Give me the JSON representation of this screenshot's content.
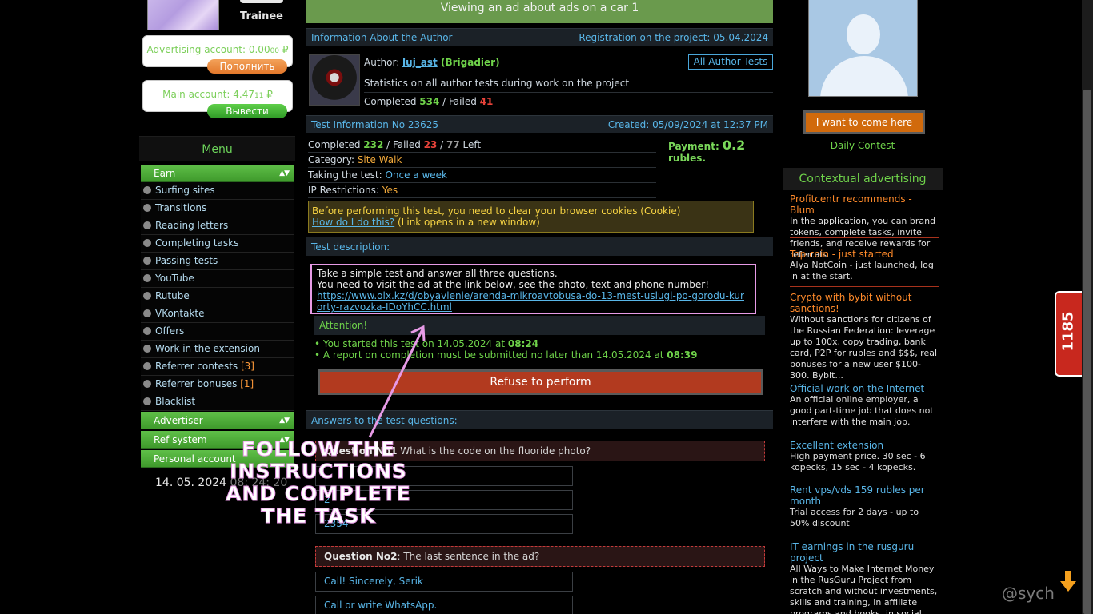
{
  "left": {
    "rank": "Trainee",
    "adv_account": {
      "label": "Advertising account: 0.00",
      "small": "00",
      "unit": " ₽",
      "button": "Пополнить"
    },
    "main_account": {
      "label": "Main account: 4.47",
      "small": "11",
      "unit": " ₽",
      "button": "Вывести"
    },
    "menu_title": "Menu",
    "earn_head": "Earn",
    "items": [
      {
        "label": "Surfing sites",
        "count": ""
      },
      {
        "label": "Transitions",
        "count": ""
      },
      {
        "label": "Reading letters",
        "count": ""
      },
      {
        "label": "Completing tasks",
        "count": ""
      },
      {
        "label": "Passing tests",
        "count": ""
      },
      {
        "label": "YouTube",
        "count": ""
      },
      {
        "label": "Rutube",
        "count": ""
      },
      {
        "label": "VKontakte",
        "count": ""
      },
      {
        "label": "Offers",
        "count": ""
      },
      {
        "label": "Work in the extension",
        "count": ""
      },
      {
        "label": "Referrer contests",
        "count": "[3]"
      },
      {
        "label": "Referrer bonuses",
        "count": "[1]"
      },
      {
        "label": "Blacklist",
        "count": ""
      }
    ],
    "advertiser_head": "Advertiser",
    "ref_head": "Ref system",
    "personal_head": "Personal account",
    "clock_date": "14. 05. 2024",
    "clock_time": "08: 24: 20"
  },
  "center": {
    "banner": "Viewing an ad about ads on a car 1",
    "author_bar": {
      "left": "Information About the Author",
      "right": "Registration on the project: 05.04.2024"
    },
    "author": {
      "label": "Author: ",
      "name": "luj_ast",
      "rank": " (Brigadier)",
      "all_tests": "All Author Tests",
      "stats_text": "Statistics on all author tests during work on the project",
      "completed_label": "Completed ",
      "completed": "534",
      "failed_label": " / Failed ",
      "failed": "41"
    },
    "test_bar": {
      "left": "Test Information No 23625",
      "right": "Created: 05/09/2024 at 12:37 PM"
    },
    "test": {
      "completed_label": "Completed ",
      "completed": "232",
      "failed_label": " / Failed ",
      "failed": "23",
      "sep": " / ",
      "left": "77",
      "left_label": " Left",
      "category_label": "Category: ",
      "category": "Site Walk",
      "taking_label": "Taking the test: ",
      "taking": "Once a week",
      "ip_label": "IP Restrictions: ",
      "ip": "Yes",
      "payment_label": "Payment: ",
      "payment": "0.2",
      "payment_unit": " rubles."
    },
    "cookie": {
      "line1": "Before performing this test, you need to clear your browser cookies (Cookie)",
      "link": "How do I do this?",
      "note": " (Link opens in a new window)"
    },
    "desc_title": "Test description:",
    "desc": {
      "line1": "Take a simple test and answer all three questions.",
      "line2": "You need to visit the ad at the link below, see the photo, text and phone number!",
      "url": "https://www.olx.kz/d/obyavlenie/arenda-mikroavtobusa-do-13-mest-uslugi-po-gorodu-kurorty-razvozka-IDoYhCC.html"
    },
    "attention": "Attention!",
    "bullet1": {
      "text": "• You started this test on 14.05.2024 at ",
      "time": "08:24"
    },
    "bullet2": {
      "text": "• A report on completion must be submitted no later than 14.05.2024 at ",
      "time": "08:39"
    },
    "refuse": "Refuse to perform",
    "answers_title": "Answers to the test questions:",
    "q1": {
      "label": "Question No1",
      "text": " What is the code on the fluoride photo?"
    },
    "q1_options": [
      "",
      "2",
      "2354"
    ],
    "q2": {
      "label": "Question No2",
      "text": ": The last sentence in the ad?"
    },
    "q2_options": [
      "Call! Sincerely, Serik",
      "Call or write WhatsApp."
    ],
    "overlay": "FOLLOW THE INSTRUCTIONS AND COMPLETE THE TASK"
  },
  "right": {
    "come_button": "I want to come here",
    "daily": "Daily Contest",
    "ctx_title": "Contextual advertising",
    "ads": [
      {
        "title": "Profitcentr recommends - Blum",
        "body": "In the application, you can brand tokens, complete tasks, invite friends, and receive rewards for referrals",
        "style": "orange"
      },
      {
        "title": "Top coin - just started",
        "body": "Alya NotCoin - just launched, log in at the start.",
        "style": "orange"
      },
      {
        "title": "Crypto with bybit without sanctions!",
        "body": "Without sanctions for citizens of the Russian Federation: leverage up to 100x, copy trading, bank card, P2P for rubles and $$$, real bonuses for a new user $100-300. Bybit...",
        "style": "orange"
      },
      {
        "title": "Official work on the Internet",
        "body": "An official online employer, a good part-time job that does not interfere with the main job.",
        "style": "blue"
      },
      {
        "title": "Excellent extension",
        "body": "High payment price. 30 sec - 6 kopecks, 15 sec - 4 kopecks.",
        "style": "blue"
      },
      {
        "title": "Rent vps/vds 159 rubles per month",
        "body": "Trial access for 2 days - up to 50% discount",
        "style": "blue"
      },
      {
        "title": "IT earnings in the rusguru project",
        "body": "All Ways to Make Internet Money in the RusGuru Project from scratch and without investments, skills and training, in affiliate programs and books, in social networks and online",
        "style": "blue"
      }
    ]
  },
  "side_tab": "1185",
  "watermark": "@sych",
  "colors": {
    "accent_green": "#6fd34a",
    "link_blue": "#59b6e8",
    "warning_orange": "#ff8a2a",
    "danger_red": "#e8433a"
  }
}
